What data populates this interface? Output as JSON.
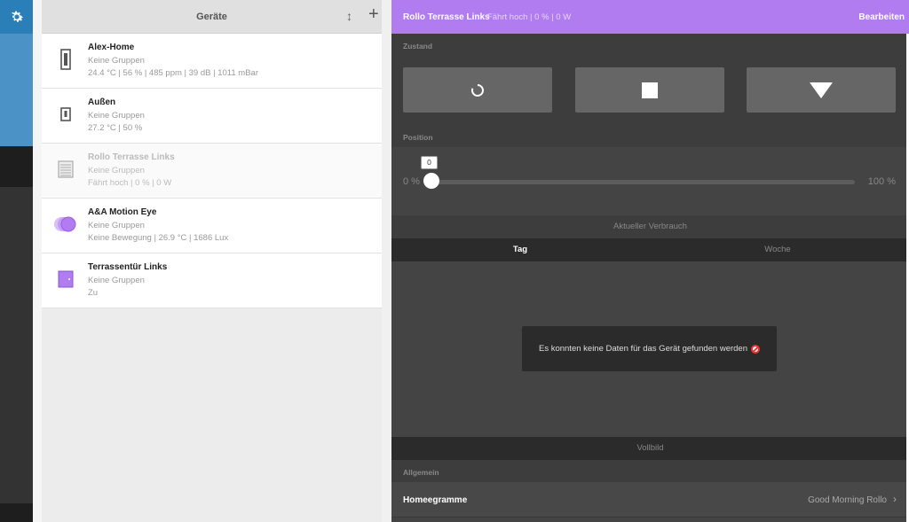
{
  "nav": {
    "settings_icon": "gear-icon",
    "accent": "#2a7fb8"
  },
  "list": {
    "title": "Geräte",
    "sort_icon": "sort-vertical-icon",
    "add_label": "+",
    "devices": [
      {
        "name": "Alex-Home",
        "group": "Keine Gruppen",
        "status": "24.4 °C | 56 % | 485 ppm | 39 dB | 1011 mBar",
        "icon": "weather-station-icon"
      },
      {
        "name": "Außen",
        "group": "Keine Gruppen",
        "status": "27.2 °C | 50 %",
        "icon": "outdoor-sensor-icon"
      },
      {
        "name": "Rollo Terrasse Links",
        "group": "Keine Gruppen",
        "status": "Fährt hoch | 0 % | 0 W",
        "icon": "shutter-icon"
      },
      {
        "name": "A&A Motion Eye",
        "group": "Keine Gruppen",
        "status": "Keine Bewegung | 26.9 °C | 1686 Lux",
        "icon": "motion-sensor-icon"
      },
      {
        "name": "Terrassentür Links",
        "group": "Keine Gruppen",
        "status": "Zu",
        "icon": "door-icon"
      }
    ]
  },
  "detail": {
    "title": "Rollo Terrasse Links",
    "subtitle": "Fährt hoch | 0 % | 0 W",
    "edit_label": "Bearbeiten",
    "accent": "#b07cf0",
    "state_label": "Zustand",
    "controls": [
      "loading-icon",
      "stop-icon",
      "down-icon"
    ],
    "position_label": "Position",
    "position": {
      "value": "0",
      "min_label": "0 %",
      "max_label": "100 %",
      "fraction": 0
    },
    "consumption_label": "Aktueller Verbrauch",
    "tabs": {
      "day": "Tag",
      "week": "Woche"
    },
    "no_data": "Es konnten keine Daten für das Gerät gefunden werden",
    "fullscreen_label": "Vollbild",
    "general_label": "Allgemein",
    "homegram": {
      "label": "Homeegramme",
      "value": "Good Morning Rollo"
    }
  }
}
